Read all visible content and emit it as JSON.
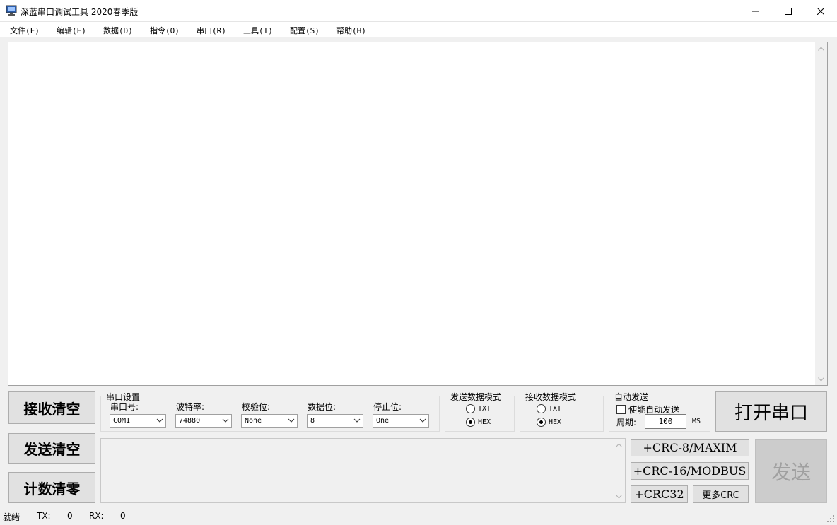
{
  "window": {
    "title": "深蓝串口调试工具 2020春季版"
  },
  "icons": {
    "app": "monitor-icon",
    "minimize": "minimize-icon",
    "maximize": "maximize-icon",
    "close": "close-icon"
  },
  "menu": [
    {
      "label": "文件(F)"
    },
    {
      "label": "编辑(E)"
    },
    {
      "label": "数据(D)"
    },
    {
      "label": "指令(O)"
    },
    {
      "label": "串口(R)"
    },
    {
      "label": "工具(T)"
    },
    {
      "label": "配置(S)"
    },
    {
      "label": "帮助(H)"
    }
  ],
  "receive": {
    "content": ""
  },
  "buttons": {
    "clear_receive": "接收清空",
    "clear_send": "发送清空",
    "reset_count": "计数清零",
    "open_port": "打开串口",
    "send": "发送",
    "crc8": "+CRC-8/MAXIM",
    "crc16": "+CRC-16/MODBUS",
    "crc32": "+CRC32",
    "more_crc": "更多CRC"
  },
  "serial_settings": {
    "title": "串口设置",
    "port_label": "串口号:",
    "port_value": "COM1",
    "baud_label": "波特率:",
    "baud_value": "74880",
    "parity_label": "校验位:",
    "parity_value": "None",
    "databits_label": "数据位:",
    "databits_value": "8",
    "stopbits_label": "停止位:",
    "stopbits_value": "One"
  },
  "send_mode": {
    "title": "发送数据模式",
    "options": [
      "TXT",
      "HEX"
    ],
    "selected": "HEX"
  },
  "recv_mode": {
    "title": "接收数据模式",
    "options": [
      "TXT",
      "HEX"
    ],
    "selected": "HEX"
  },
  "auto_send": {
    "title": "自动发送",
    "enable_label": "使能自动发送",
    "enabled": false,
    "period_label": "周期:",
    "period_value": "100",
    "unit": "MS"
  },
  "send_text": "",
  "status": {
    "ready": "就绪",
    "tx_label": "TX:",
    "tx_value": "0",
    "rx_label": "RX:",
    "rx_value": "0"
  },
  "colors": {
    "disabled_text": "#a0a0a0",
    "button_face": "#e1e1e1",
    "window_bg": "#f0f0f0"
  }
}
